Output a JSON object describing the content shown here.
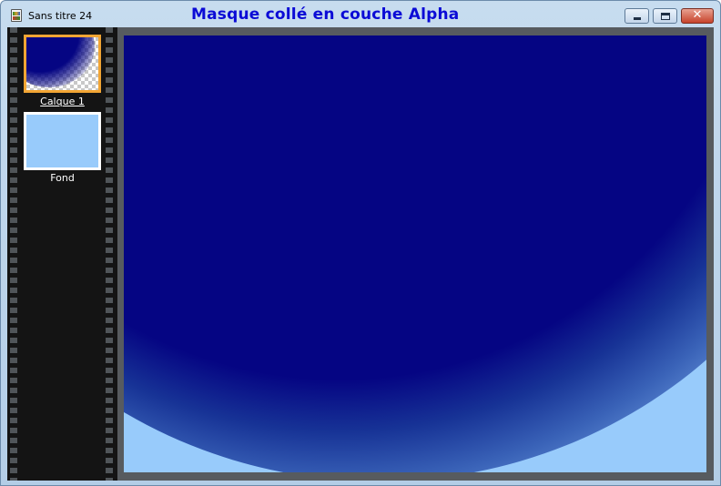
{
  "window": {
    "title": "Sans titre 24",
    "overlay_text": "Masque collé en couche Alpha",
    "controls": {
      "minimize": "",
      "maximize": "",
      "close": "✕"
    }
  },
  "layers": [
    {
      "name": "Calque 1",
      "selected": true
    },
    {
      "name": "Fond",
      "selected": false
    }
  ],
  "colors": {
    "layer_fill": "#050583",
    "background_fill": "#98cbfb",
    "selection_border": "#f2a534",
    "overlay_text": "#0b0bd6"
  }
}
